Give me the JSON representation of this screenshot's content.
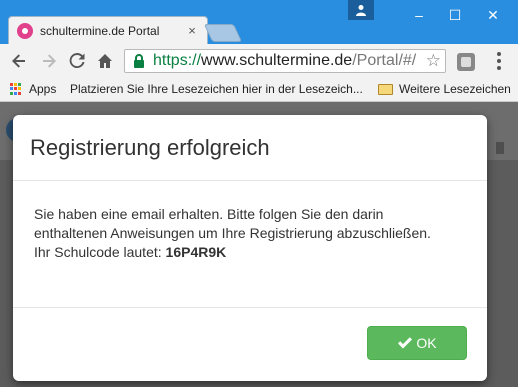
{
  "browser": {
    "tab_title": "schultermine.de Portal",
    "tab_close": "×",
    "url_protocol": "https://",
    "url_host": "www.schultermine.de",
    "url_path": "/Portal/#/",
    "window_min": "–",
    "window_max": "☐",
    "window_close": "✕"
  },
  "bookmarks": {
    "apps_label": "Apps",
    "placeholder_label": "Platzieren Sie Ihre Lesezeichen hier in der Lesezeich...",
    "other_label": "Weitere Lesezeichen"
  },
  "modal": {
    "title": "Registrierung erfolgreich",
    "body_line1": "Sie haben eine email erhalten. Bitte folgen Sie den darin",
    "body_line2": "enthaltenen Anweisungen um Ihre Registrierung abzuschließen.",
    "code_prefix": "Ihr Schulcode lautet: ",
    "code": "16P4R9K",
    "ok_label": "OK"
  },
  "colors": {
    "accent": "#5cb85c",
    "titlebar": "#2a8ee0",
    "url_secure": "#0b8043",
    "favicon": "#e0408c"
  },
  "icons": [
    "user-icon",
    "minimize-icon",
    "maximize-icon",
    "close-icon",
    "back-icon",
    "forward-icon",
    "reload-icon",
    "home-icon",
    "lock-icon",
    "star-icon",
    "extension-icon",
    "menu-icon",
    "apps-icon",
    "folder-icon",
    "checkmark-icon"
  ]
}
